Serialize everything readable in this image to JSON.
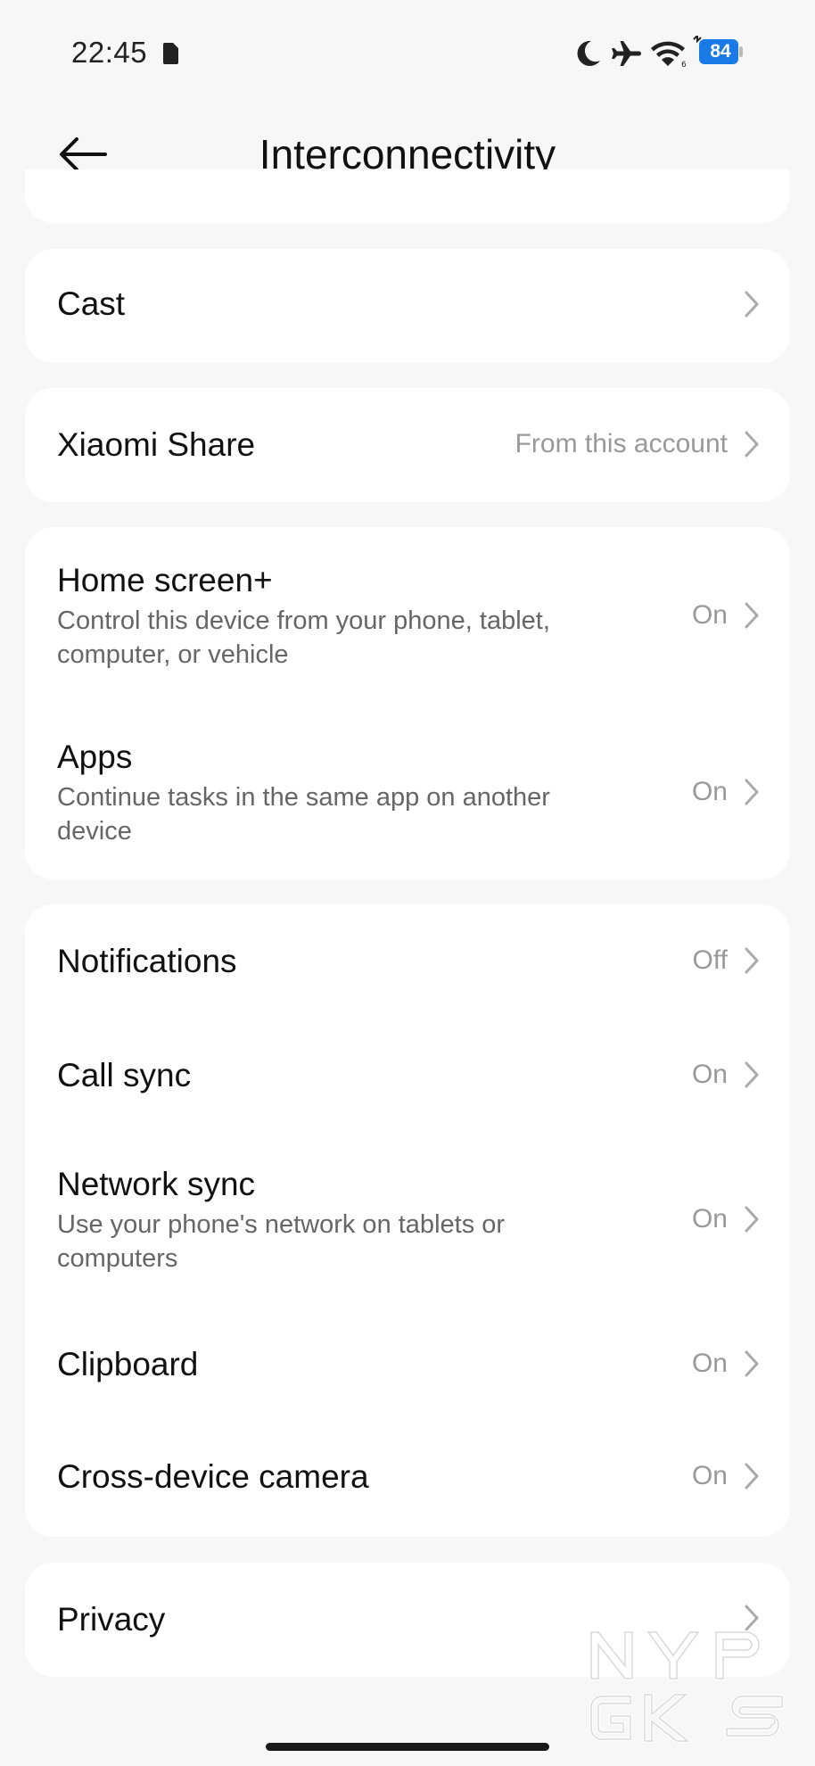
{
  "status_bar": {
    "time": "22:45",
    "battery_level": "84",
    "icons": [
      "sim-card-icon",
      "moon-icon",
      "airplane-icon",
      "wifi-icon",
      "battery-icon"
    ]
  },
  "header": {
    "title": "Interconnectivity",
    "back_icon": "arrow-left-icon"
  },
  "sections": {
    "cast": {
      "title": "Cast"
    },
    "xiaomi_share": {
      "title": "Xiaomi Share",
      "value": "From this account"
    },
    "home_screen": {
      "title": "Home screen+",
      "subtitle_line1": "Control this device from your phone, tablet,",
      "subtitle_line2": "computer, or vehicle",
      "value": "On"
    },
    "apps": {
      "title": "Apps",
      "subtitle_line1": "Continue tasks in the same app on another",
      "subtitle_line2": "device",
      "value": "On"
    },
    "notifications": {
      "title": "Notifications",
      "value": "Off"
    },
    "call_sync": {
      "title": "Call sync",
      "value": "On"
    },
    "network_sync": {
      "title": "Network sync",
      "subtitle_line1": "Use your phone's network on tablets or",
      "subtitle_line2": "computers",
      "value": "On"
    },
    "clipboard": {
      "title": "Clipboard",
      "value": "On"
    },
    "cross_device_camera": {
      "title": "Cross-device camera",
      "value": "On"
    },
    "privacy": {
      "title": "Privacy"
    }
  },
  "colors": {
    "background": "#f7f7f7",
    "card": "#ffffff",
    "battery_badge": "#1a7ae8",
    "secondary_text": "#999999"
  }
}
